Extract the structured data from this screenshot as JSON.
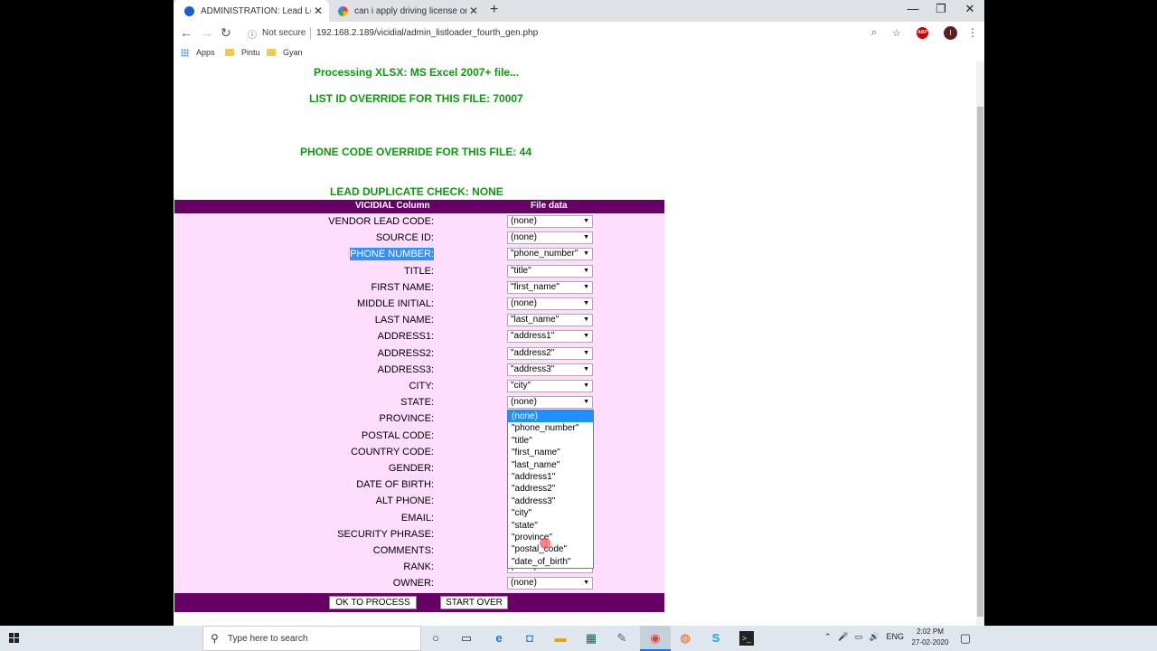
{
  "browser": {
    "tabs": [
      {
        "label": "ADMINISTRATION: Lead Loader",
        "close": "✕"
      },
      {
        "label": "can i apply driving license online",
        "close": "✕"
      }
    ],
    "new_tab": "+",
    "window_controls": {
      "minimize": "—",
      "maximize": "❐",
      "close": "✕"
    },
    "nav": {
      "back": "←",
      "forward": "→",
      "reload": "↻"
    },
    "security_label": "Not secure",
    "url": "192.168.2.189/vicidial/admin_listloader_fourth_gen.php",
    "profile_initial": "I",
    "adblock_label": "ABP",
    "bookmarks": [
      {
        "label": "Apps"
      },
      {
        "label": "Pintu"
      },
      {
        "label": "Gyan"
      }
    ]
  },
  "page": {
    "processing_text": "Processing XLSX: MS Excel 2007+ file...",
    "list_id_text": "LIST ID OVERRIDE FOR THIS FILE: 70007",
    "phone_code_text": "PHONE CODE OVERRIDE FOR THIS FILE: 44",
    "dup_check_text": "LEAD DUPLICATE CHECK: NONE",
    "table": {
      "col1": "VICIDIAL Column",
      "col2": "File data",
      "rows": [
        {
          "label": "VENDOR LEAD CODE:",
          "value": "(none)"
        },
        {
          "label": "SOURCE ID:",
          "value": "(none)"
        },
        {
          "label": "PHONE NUMBER:",
          "value": "\"phone_number\""
        },
        {
          "label": "TITLE:",
          "value": "\"title\""
        },
        {
          "label": "FIRST NAME:",
          "value": "\"first_name\""
        },
        {
          "label": "MIDDLE INITIAL:",
          "value": "(none)"
        },
        {
          "label": "LAST NAME:",
          "value": "\"last_name\""
        },
        {
          "label": "ADDRESS1:",
          "value": "\"address1\""
        },
        {
          "label": "ADDRESS2:",
          "value": "\"address2\""
        },
        {
          "label": "ADDRESS3:",
          "value": "\"address3\""
        },
        {
          "label": "CITY:",
          "value": "\"city\""
        },
        {
          "label": "STATE:",
          "value": "(none)"
        },
        {
          "label": "PROVINCE:",
          "value": ""
        },
        {
          "label": "POSTAL CODE:",
          "value": ""
        },
        {
          "label": "COUNTRY CODE:",
          "value": ""
        },
        {
          "label": "GENDER:",
          "value": ""
        },
        {
          "label": "DATE OF BIRTH:",
          "value": ""
        },
        {
          "label": "ALT PHONE:",
          "value": ""
        },
        {
          "label": "EMAIL:",
          "value": ""
        },
        {
          "label": "SECURITY PHRASE:",
          "value": ""
        },
        {
          "label": "COMMENTS:",
          "value": ""
        },
        {
          "label": "RANK:",
          "value": "(none)"
        },
        {
          "label": "OWNER:",
          "value": "(none)"
        }
      ],
      "dropdown_options": [
        "(none)",
        "\"phone_number\"",
        "\"title\"",
        "\"first_name\"",
        "\"last_name\"",
        "\"address1\"",
        "\"address2\"",
        "\"address3\"",
        "\"city\"",
        "\"state\"",
        "\"province\"",
        "\"postal_code\"",
        "\"date_of_birth\""
      ],
      "ok_button": "OK TO PROCESS",
      "start_over_button": "START OVER"
    }
  },
  "taskbar": {
    "search_placeholder": "Type here to search",
    "tray_lang": "ENG",
    "time": "2:02 PM",
    "date": "27-02-2020"
  },
  "colors": {
    "header_purple": "#660066",
    "table_pink": "#ffddff",
    "text_green": "#0b9b0b",
    "highlight_blue": "#1e90ff"
  }
}
